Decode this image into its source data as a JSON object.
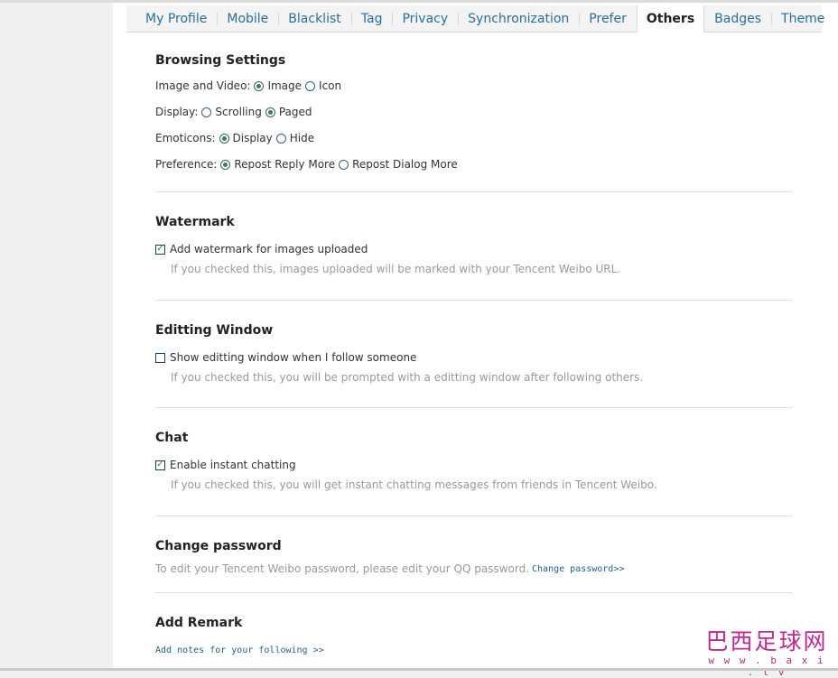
{
  "tabs": [
    {
      "label": "My Profile"
    },
    {
      "label": "Mobile"
    },
    {
      "label": "Blacklist"
    },
    {
      "label": "Tag"
    },
    {
      "label": "Privacy"
    },
    {
      "label": "Synchronization"
    },
    {
      "label": "Prefer"
    },
    {
      "label": "Others"
    },
    {
      "label": "Badges"
    },
    {
      "label": "Theme"
    }
  ],
  "active_tab": "Others",
  "browsing": {
    "title": "Browsing Settings",
    "image_video": {
      "label": "Image and Video:",
      "options": [
        "Image",
        "Icon"
      ],
      "selected": "Image"
    },
    "display": {
      "label": "Display:",
      "options": [
        "Scrolling",
        "Paged"
      ],
      "selected": "Paged"
    },
    "emoticons": {
      "label": "Emoticons:",
      "options": [
        "Display",
        "Hide"
      ],
      "selected": "Display"
    },
    "preference": {
      "label": "Preference:",
      "options": [
        "Repost Reply More",
        "Repost Dialog More"
      ],
      "selected": "Repost Reply More"
    }
  },
  "watermark": {
    "title": "Watermark",
    "checkbox_label": "Add watermark for images uploaded",
    "checked": true,
    "hint": "If you checked this, images uploaded will be marked with your Tencent Weibo URL."
  },
  "editing": {
    "title": "Editting Window",
    "checkbox_label": "Show editting window when I follow someone",
    "checked": false,
    "hint": "If you checked this, you will be prompted with a editting window after following others."
  },
  "chat": {
    "title": "Chat",
    "checkbox_label": "Enable instant chatting",
    "checked": true,
    "hint": "If you checked this, you will get instant chatting messages from friends in Tencent Weibo."
  },
  "password": {
    "title": "Change password",
    "text": "To edit your Tencent Weibo password, please edit your QQ password.",
    "link": "Change password>>"
  },
  "remark": {
    "title": "Add Remark",
    "link": "Add notes for your following >>"
  },
  "site_watermark": {
    "text": "巴西足球网",
    "url": "w w w . b a x i . t v"
  },
  "colors": {
    "tab_link": "#2a6f9a",
    "check_green": "#2b8a3e",
    "hint_gray": "#999999",
    "watermark_magenta": "#c0288f"
  }
}
